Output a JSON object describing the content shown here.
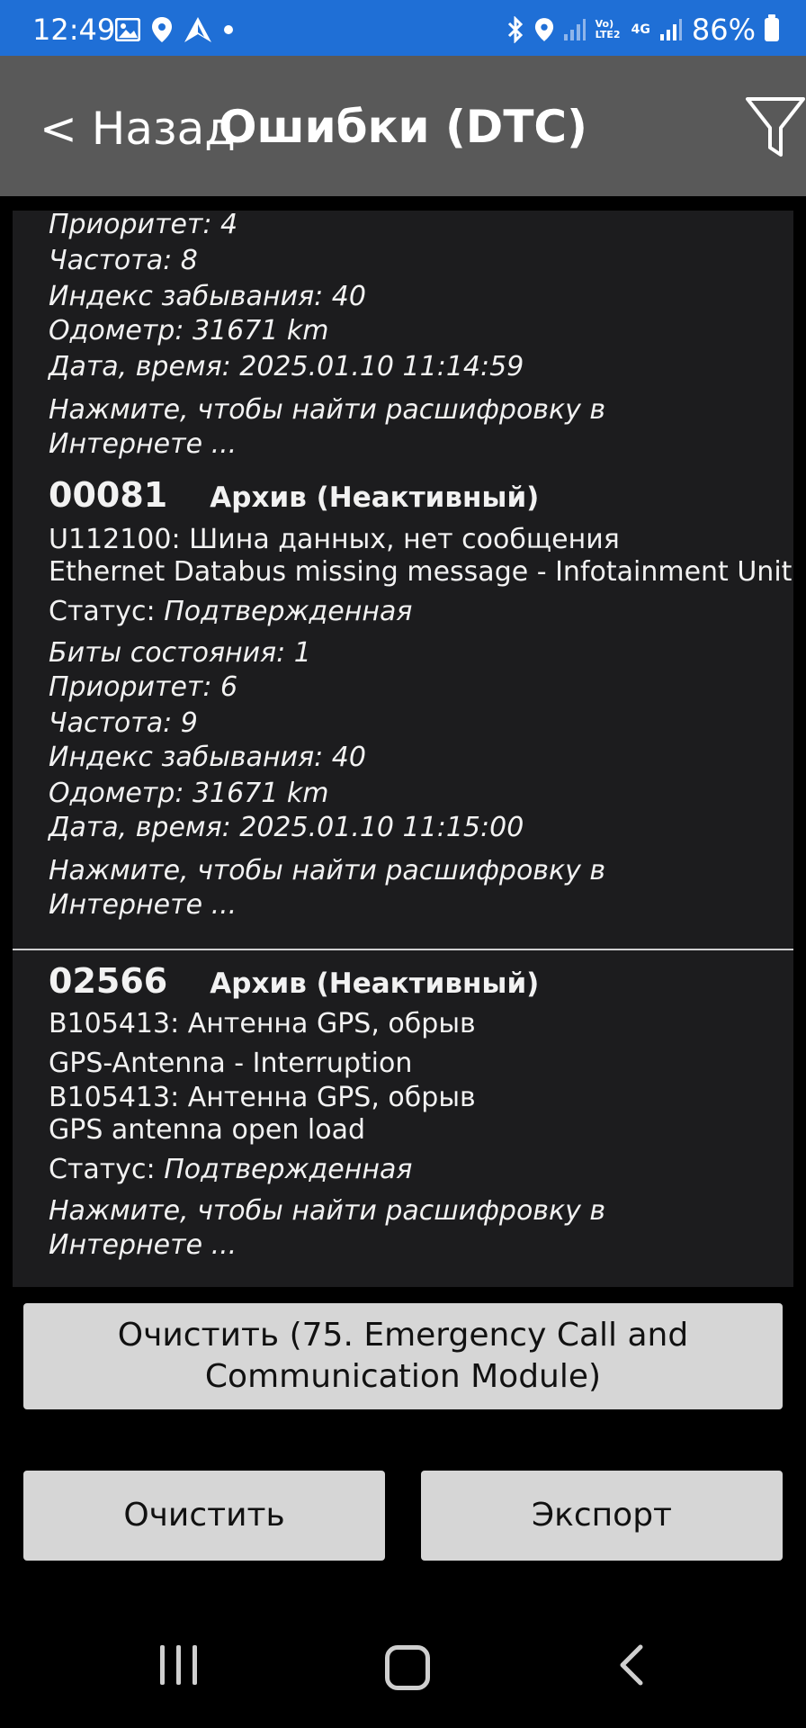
{
  "status_bar": {
    "time": "12:49",
    "lte_label": "Vo) LTE2",
    "net_label": "4G",
    "battery": "86%"
  },
  "header": {
    "back_label": "< Назад",
    "title": "Ошибки (DTC)"
  },
  "list": [
    {
      "partial": true,
      "lines": [
        {
          "text": "Приоритет: 4",
          "style": "it"
        },
        {
          "text": "Частота: 8",
          "style": "it"
        },
        {
          "text": "Индекс забывания: 40",
          "style": "it"
        },
        {
          "text": "Одометр: 31671 km",
          "style": "it"
        },
        {
          "text": "Дата, время: 2025.01.10 11:14:59",
          "style": "it"
        },
        {
          "text": "Нажмите, чтобы найти расшифровку в",
          "style": "it"
        },
        {
          "text": "Интернете ...",
          "style": "it"
        }
      ]
    },
    {
      "code": "00081",
      "status": "Архив (Неактивный)",
      "lines": [
        {
          "text": "U112100: Шина данных, нет сообщения",
          "style": "normal"
        },
        {
          "text": "Ethernet Databus missing message - Infotainment Unit",
          "style": "normal"
        },
        {
          "label": "Статус: ",
          "value": "Подтвержденная"
        },
        {
          "text": "Биты состояния: 1",
          "style": "it"
        },
        {
          "text": "Приоритет: 6",
          "style": "it"
        },
        {
          "text": "Частота: 9",
          "style": "it"
        },
        {
          "text": "Индекс забывания: 40",
          "style": "it"
        },
        {
          "text": "Одометр: 31671 km",
          "style": "it"
        },
        {
          "text": "Дата, время: 2025.01.10 11:15:00",
          "style": "it"
        },
        {
          "text": "Нажмите, чтобы найти расшифровку в",
          "style": "it"
        },
        {
          "text": "Интернете ...",
          "style": "it"
        }
      ]
    },
    {
      "code": "02566",
      "status": "Архив (Неактивный)",
      "lines": [
        {
          "text": "B105413: Антенна GPS, обрыв",
          "style": "normal"
        },
        {
          "text": "GPS-Antenna - Interruption",
          "style": "normal"
        },
        {
          "text": "B105413: Антенна GPS, обрыв",
          "style": "normal"
        },
        {
          "text": "GPS antenna open load",
          "style": "normal"
        },
        {
          "label": "Статус: ",
          "value": "Подтвержденная"
        },
        {
          "text": "Нажмите, чтобы найти расшифровку в",
          "style": "it"
        },
        {
          "text": "Интернете ...",
          "style": "it"
        }
      ]
    }
  ],
  "buttons": {
    "clear_module_line1": "Очистить (75. Emergency Call and",
    "clear_module_line2": "Communication Module)",
    "clear": "Очистить",
    "export": "Экспорт"
  }
}
